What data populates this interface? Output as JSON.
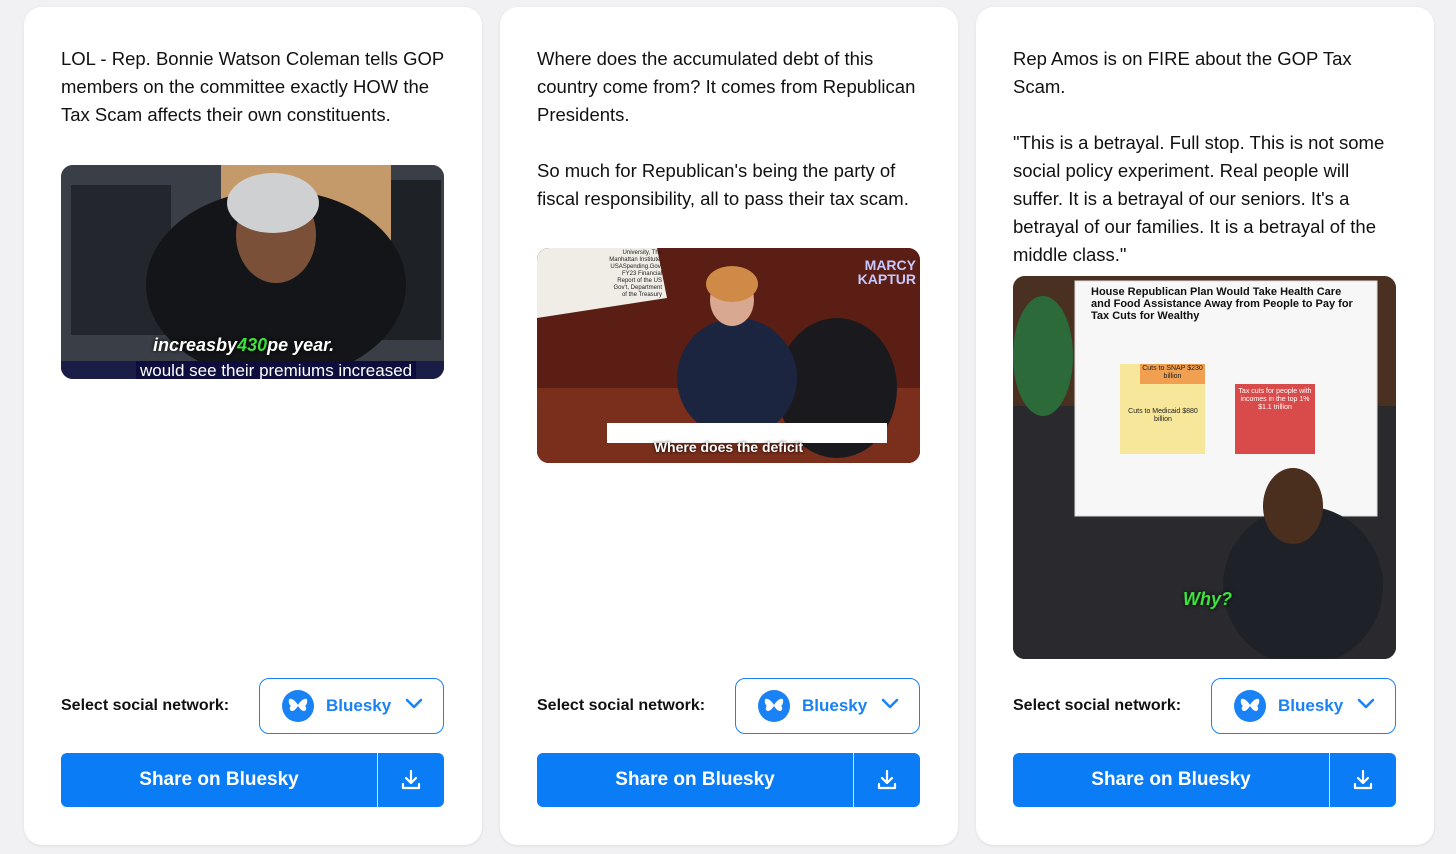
{
  "cards": [
    {
      "text": "LOL - Rep. Bonnie Watson Coleman tells GOP members on the committee exactly HOW the Tax Scam affects their own constituents.",
      "caption_before": "increasby",
      "caption_highlight": "430",
      "caption_after": "pe year.",
      "subtitle": "would see their premiums increased",
      "select_label": "Select social network:",
      "network": "Bluesky",
      "share_label": "Share on Bluesky"
    },
    {
      "text": "Where does the accumulated debt of this country come from? It comes from Republican Presidents.\n\nSo much for Republican's being the party of fiscal responsibility, all to pass their tax scam.",
      "sign_text": "University, The Manhattan Institute, USASpending.Gov, FY23 Financial Report of the US Gov't, Department of the Treasury",
      "logo_text": "MARCY KAPTUR",
      "video_caption": "Where does the deficit",
      "select_label": "Select social network:",
      "network": "Bluesky",
      "share_label": "Share on Bluesky"
    },
    {
      "text": "Rep Amos is on FIRE about the GOP Tax Scam.\n\n\"This is a betrayal. Full stop. This is not some social policy experiment. Real people will suffer. It is a betrayal of our seniors. It's a betrayal of our families. It is a betrayal of the middle class.\"",
      "poster_title": "House Republican Plan Would Take Health Care and Food Assistance Away from People to Pay for Tax Cuts for Wealthy",
      "poster_snap": "Cuts to SNAP $230 billion",
      "poster_medicaid": "Cuts to Medicaid $880 billion",
      "poster_taxcuts": "Tax cuts for people with incomes in the top 1% $1.1 trillion",
      "video_caption": "Why?",
      "select_label": "Select social network:",
      "network": "Bluesky",
      "share_label": "Share on Bluesky"
    }
  ],
  "colors": {
    "accent": "#0a7cf5",
    "highlight": "#3ce33c"
  },
  "icons": {
    "network": "butterfly-icon",
    "dropdown": "chevron-down-icon",
    "download": "download-icon"
  }
}
